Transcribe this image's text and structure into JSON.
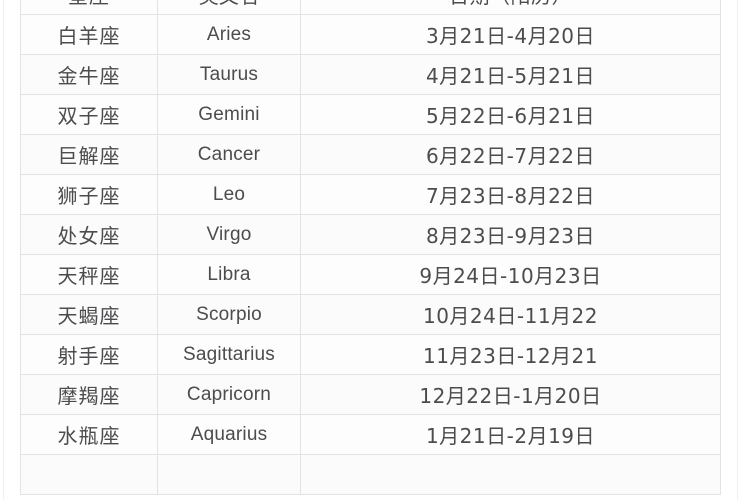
{
  "table": {
    "columns": [
      {
        "key": "cn",
        "label": "星座"
      },
      {
        "key": "en",
        "label": "英文名"
      },
      {
        "key": "date",
        "label": "日期（阳历）"
      }
    ],
    "rows": [
      {
        "cn": "白羊座",
        "en": "Aries",
        "date": "3月21日-4月20日"
      },
      {
        "cn": "金牛座",
        "en": "Taurus",
        "date": "4月21日-5月21日"
      },
      {
        "cn": "双子座",
        "en": "Gemini",
        "date": "5月22日-6月21日"
      },
      {
        "cn": "巨解座",
        "en": "Cancer",
        "date": "6月22日-7月22日"
      },
      {
        "cn": "狮子座",
        "en": "Leo",
        "date": "7月23日-8月22日"
      },
      {
        "cn": "处女座",
        "en": "Virgo",
        "date": "8月23日-9月23日"
      },
      {
        "cn": "天秤座",
        "en": "Libra",
        "date": "9月24日-10月23日"
      },
      {
        "cn": "天蝎座",
        "en": "Scorpio",
        "date": "10月24日-11月22"
      },
      {
        "cn": "射手座",
        "en": "Sagittarius",
        "date": "11月23日-12月21"
      },
      {
        "cn": "摩羯座",
        "en": "Capricorn",
        "date": "12月22日-1月20日"
      },
      {
        "cn": "水瓶座",
        "en": "Aquarius",
        "date": "1月21日-2月19日"
      },
      {
        "cn": "",
        "en": "",
        "date": ""
      }
    ]
  },
  "colors": {
    "text": "#4c4c4e",
    "border": "#e3e3e5",
    "background": "#fdfdfd",
    "row_alt": "#fbfbfc"
  }
}
